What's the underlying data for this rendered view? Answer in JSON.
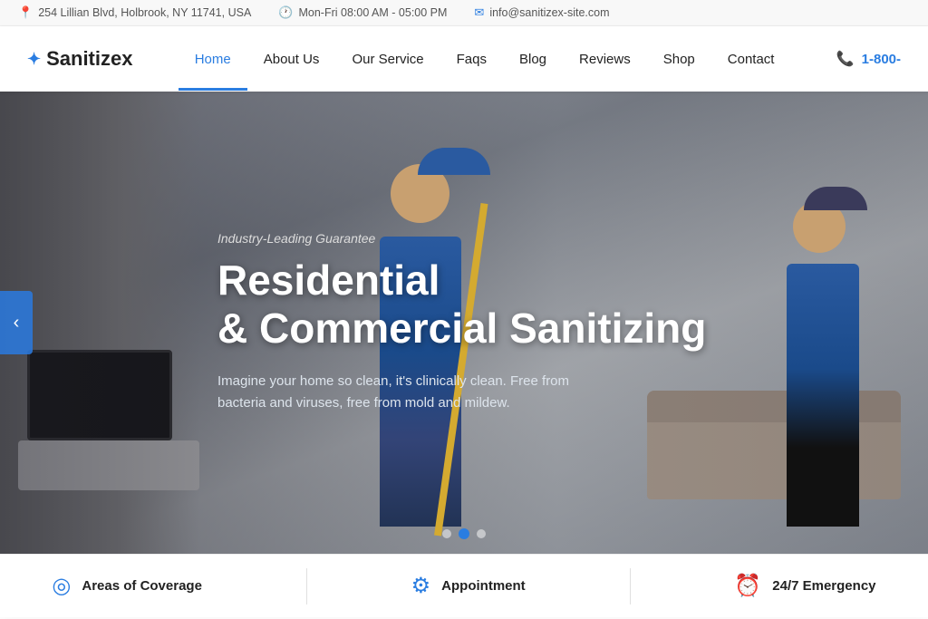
{
  "topbar": {
    "address": "254 Lillian Blvd, Holbrook, NY 11741, USA",
    "hours": "Mon-Fri 08:00 AM - 05:00 PM",
    "email": "info@sanitizex-site.com"
  },
  "header": {
    "logo_text": "Sanitizex",
    "phone": "1-800-",
    "nav_items": [
      {
        "label": "Home",
        "active": true
      },
      {
        "label": "About Us",
        "active": false
      },
      {
        "label": "Our Service",
        "active": false
      },
      {
        "label": "Faqs",
        "active": false
      },
      {
        "label": "Blog",
        "active": false
      },
      {
        "label": "Reviews",
        "active": false
      },
      {
        "label": "Shop",
        "active": false
      },
      {
        "label": "Contact",
        "active": false
      }
    ]
  },
  "hero": {
    "tag": "Industry-Leading Guarantee",
    "title": "Residential\n& Commercial Sanitizing",
    "description": "Imagine your home so clean, it's clinically clean. Free from bacteria and viruses, free from mold and mildew."
  },
  "bottom_bar": {
    "items": [
      {
        "icon": "◎",
        "label": "Areas of Coverage"
      },
      {
        "icon": "⚙",
        "label": "Appointment"
      },
      {
        "icon": "⏰",
        "label": "24/7 Emergency"
      }
    ]
  },
  "slider": {
    "dots": [
      {
        "active": false
      },
      {
        "active": true
      },
      {
        "active": false
      }
    ]
  }
}
